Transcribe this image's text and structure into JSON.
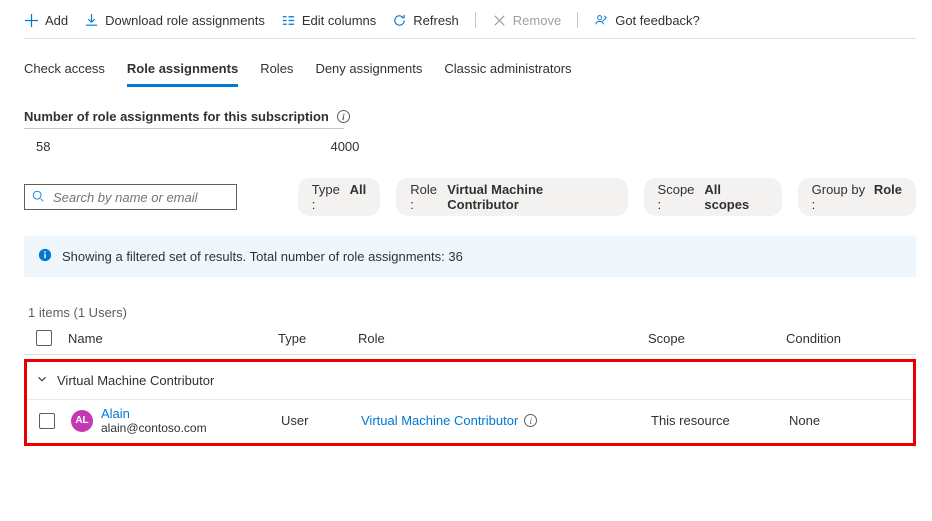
{
  "toolbar": {
    "add": "Add",
    "download": "Download role assignments",
    "edit": "Edit columns",
    "refresh": "Refresh",
    "remove": "Remove",
    "feedback": "Got feedback?"
  },
  "tabs": {
    "check": "Check access",
    "assignments": "Role assignments",
    "roles": "Roles",
    "deny": "Deny assignments",
    "classic": "Classic administrators"
  },
  "countHeading": "Number of role assignments for this subscription",
  "countCurrent": "58",
  "countMax": "4000",
  "searchPlaceholder": "Search by name or email",
  "filters": {
    "typeLabel": "Type : ",
    "typeValue": "All",
    "roleLabel": "Role : ",
    "roleValue": "Virtual Machine Contributor",
    "scopeLabel": "Scope : ",
    "scopeValue": "All scopes",
    "groupLabel": "Group by : ",
    "groupValue": "Role"
  },
  "infoBar": "Showing a filtered set of results. Total number of role assignments: 36",
  "itemsCount": "1 items (1 Users)",
  "columns": {
    "name": "Name",
    "type": "Type",
    "role": "Role",
    "scope": "Scope",
    "condition": "Condition"
  },
  "group": {
    "title": "Virtual Machine Contributor"
  },
  "rows": [
    {
      "initials": "AL",
      "name": "Alain",
      "email": "alain@contoso.com",
      "type": "User",
      "role": "Virtual Machine Contributor",
      "scope": "This resource",
      "condition": "None"
    }
  ]
}
